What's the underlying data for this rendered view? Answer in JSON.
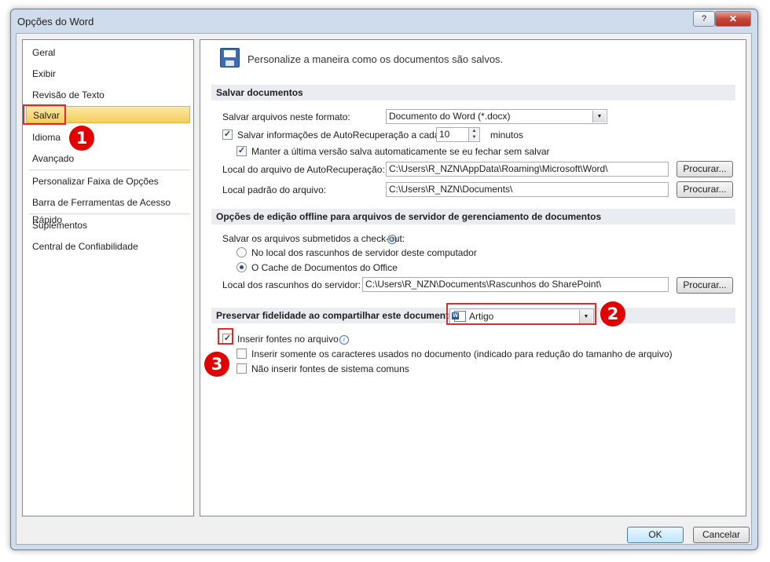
{
  "window": {
    "title": "Opções do Word",
    "help": "?",
    "close": "✕"
  },
  "nav": {
    "items": [
      {
        "label": "Geral"
      },
      {
        "label": "Exibir"
      },
      {
        "label": "Revisão de Texto"
      },
      {
        "label": "Salvar",
        "selected": true
      },
      {
        "label": "Idioma"
      },
      {
        "label": "Avançado"
      },
      {
        "label": "Personalizar Faixa de Opções"
      },
      {
        "label": "Barra de Ferramentas de Acesso Rápido"
      },
      {
        "label": "Suplementos"
      },
      {
        "label": "Central de Confiabilidade"
      }
    ]
  },
  "header": {
    "text": "Personalize a maneira como os documentos são salvos."
  },
  "salvar": {
    "heading": "Salvar documentos",
    "formato_label": "Salvar arquivos neste formato:",
    "formato_value": "Documento do Word (*.docx)",
    "autorec_label": "Salvar informações de AutoRecuperação a cada",
    "autorec_checked": true,
    "autorec_minutes": "10",
    "minutos": "minutos",
    "manter_label": "Manter a última versão salva automaticamente se eu fechar sem salvar",
    "manter_checked": true,
    "local_auto_label": "Local do arquivo de AutoRecuperação:",
    "local_auto_value": "C:\\Users\\R_NZN\\AppData\\Roaming\\Microsoft\\Word\\",
    "local_padrao_label": "Local padrão do arquivo:",
    "local_padrao_value": "C:\\Users\\R_NZN\\Documents\\",
    "procurar": "Procurar..."
  },
  "offline": {
    "heading": "Opções de edição offline para arquivos de servidor de gerenciamento de documentos",
    "checkout_label": "Salvar os arquivos submetidos a check-out:",
    "radio1": "No local dos rascunhos de servidor deste computador",
    "radio2": "O Cache de Documentos do Office",
    "selected": 2,
    "rascunhos_label": "Local dos rascunhos do servidor:",
    "rascunhos_value": "C:\\Users\\R_NZN\\Documents\\Rascunhos do SharePoint\\",
    "procurar": "Procurar..."
  },
  "fidelidade": {
    "heading": "Preservar fidelidade ao compartilhar este documento:",
    "doc_value": "Artigo",
    "inserir_fontes": "Inserir fontes no arquivo",
    "inserir_fontes_checked": true,
    "somente_caracteres": "Inserir somente os caracteres usados no documento (indicado para redução do tamanho de arquivo)",
    "somente_checked": false,
    "nao_inserir": "Não inserir fontes de sistema comuns",
    "nao_inserir_checked": false
  },
  "annotations": {
    "b1": "1",
    "b2": "2",
    "b3": "3"
  },
  "footer": {
    "ok": "OK",
    "cancel": "Cancelar"
  },
  "colors": {
    "annotation_red": "#e10000",
    "selected_nav": "#f6cd5c",
    "section_header": "#e9ecf0"
  }
}
